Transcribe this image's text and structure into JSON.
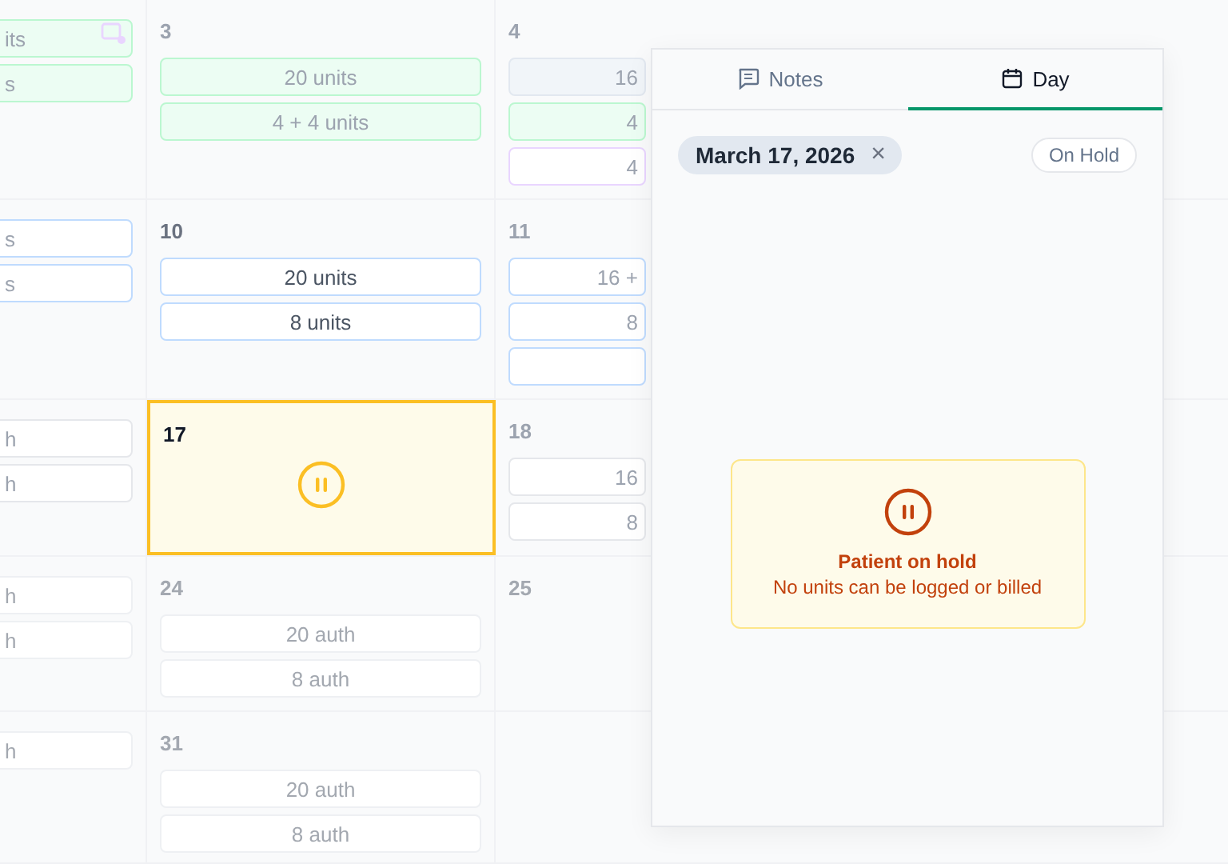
{
  "calendar": {
    "weeks": [
      {
        "days": [
          {
            "chips": [
              {
                "text": "its",
                "color": "#bbf7d0"
              },
              {
                "text": "s",
                "color": "#bbf7d0"
              }
            ]
          },
          {
            "date": "3",
            "selected": false,
            "chips": [
              {
                "text": "20 units",
                "color": "#bbf7d0"
              },
              {
                "text": "4 + 4 units",
                "color": "#bbf7d0"
              }
            ]
          },
          {
            "date": "4",
            "selected": false,
            "chips": [
              {
                "text": "16",
                "color": "#e2e8f0"
              },
              {
                "text": "4",
                "color": "#bbf7d0"
              },
              {
                "text": "4",
                "color": "#e9d5ff"
              }
            ]
          }
        ]
      },
      {
        "days": [
          {
            "chips": [
              {
                "text": "s",
                "color": "#bfdbfe"
              },
              {
                "text": "s",
                "color": "#bfdbfe"
              }
            ]
          },
          {
            "date": "10",
            "selected": false,
            "chips": [
              {
                "text": "20 units",
                "color": "#bfdbfe"
              },
              {
                "text": "8 units",
                "color": "#bfdbfe"
              }
            ]
          },
          {
            "date": "11",
            "selected": false,
            "chips": [
              {
                "text": "16 +",
                "color": "#bfdbfe"
              },
              {
                "text": "8",
                "color": "#bfdbfe"
              },
              {
                "color": "#bfdbfe"
              }
            ]
          }
        ]
      },
      {
        "days": [
          {
            "chips": [
              {
                "text": "h",
                "color": "#e5e7eb"
              },
              {
                "text": "h",
                "color": "#e5e7eb"
              }
            ]
          },
          {
            "date": "17",
            "selected": true
          },
          {
            "date": "18",
            "selected": false,
            "chips": [
              {
                "text": "16",
                "color": "#e5e7eb"
              },
              {
                "text": "8",
                "color": "#e5e7eb"
              }
            ]
          }
        ]
      },
      {
        "days": [
          {
            "chips": [
              {
                "text": "h",
                "color": "#e5e7eb"
              },
              {
                "text": "h",
                "color": "#e5e7eb"
              }
            ]
          },
          {
            "date": "24",
            "selected": false,
            "chips": [
              {
                "text": "20 auth",
                "color": "#e5e7eb"
              },
              {
                "text": "8 auth",
                "color": "#e5e7eb"
              }
            ]
          },
          {
            "date": "25",
            "selected": false
          }
        ]
      },
      {
        "days": [
          {
            "chips": [
              {
                "text": "h",
                "color": "#e5e7eb"
              }
            ]
          },
          {
            "date": "31",
            "selected": false,
            "chips": [
              {
                "text": "20 auth",
                "color": "#e5e7eb"
              },
              {
                "text": "8 auth",
                "color": "#e5e7eb"
              }
            ]
          }
        ]
      }
    ]
  },
  "panel": {
    "tabs": [
      {
        "label": "Notes",
        "selected": false
      },
      {
        "label": "Day",
        "selected": true
      }
    ],
    "date_chip": "March 17, 2026",
    "close": "×",
    "status_badge": "On Hold",
    "hold_notice": {
      "title": "Patient on hold",
      "message": "No units can be logged or billed"
    }
  }
}
